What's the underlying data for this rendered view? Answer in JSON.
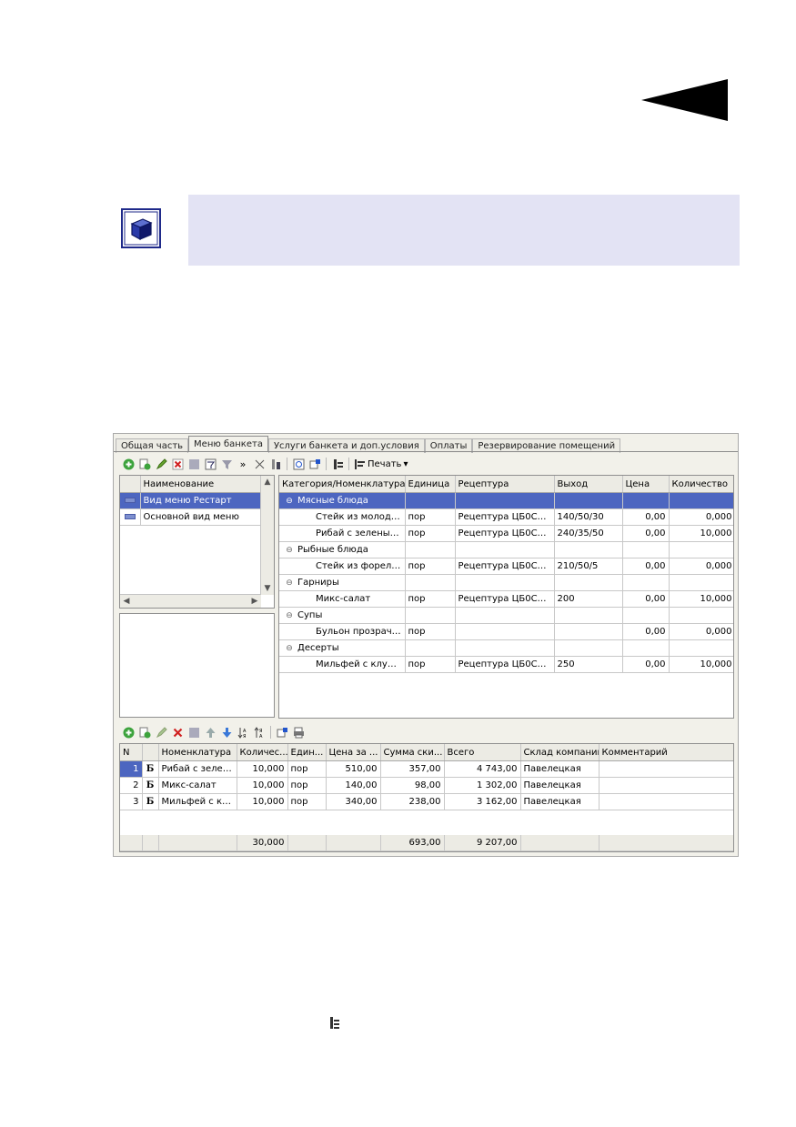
{
  "tabs": [
    {
      "label": "Общая часть"
    },
    {
      "label": "Меню банкета"
    },
    {
      "label": "Услуги банкета и доп.условия"
    },
    {
      "label": "Оплаты"
    },
    {
      "label": "Резервирование помещений"
    }
  ],
  "toolbar_top": {
    "print_label": "Печать"
  },
  "left_list": {
    "header": "Наименование",
    "rows": [
      {
        "name": "Вид меню Рестарт"
      },
      {
        "name": "Основной вид меню"
      }
    ]
  },
  "menu_table": {
    "headers": [
      "Категория/Номенклатура",
      "Единица",
      "Рецептура",
      "Выход",
      "Цена",
      "Количество"
    ],
    "rows": [
      {
        "kind": "group",
        "name": "Мясные блюда",
        "unit": "",
        "recipe": "",
        "output": "",
        "price": "",
        "qty": ""
      },
      {
        "kind": "item",
        "name": "Стейк из молодо...",
        "unit": "пор",
        "recipe": "Рецептура ЦБ0С00...",
        "output": "140/50/30",
        "price": "0,00",
        "qty": "0,000"
      },
      {
        "kind": "item",
        "name": "Рибай с зеленым...",
        "unit": "пор",
        "recipe": "Рецептура ЦБ0С00...",
        "output": "240/35/50",
        "price": "0,00",
        "qty": "10,000"
      },
      {
        "kind": "group",
        "name": "Рыбные блюда",
        "unit": "",
        "recipe": "",
        "output": "",
        "price": "",
        "qty": ""
      },
      {
        "kind": "item",
        "name": "Стейк из форели ...",
        "unit": "пор",
        "recipe": "Рецептура ЦБ0С00...",
        "output": "210/50/5",
        "price": "0,00",
        "qty": "0,000"
      },
      {
        "kind": "group",
        "name": "Гарниры",
        "unit": "",
        "recipe": "",
        "output": "",
        "price": "",
        "qty": ""
      },
      {
        "kind": "item",
        "name": "Микс-салат",
        "unit": "пор",
        "recipe": "Рецептура ЦБ0С00...",
        "output": "200",
        "price": "0,00",
        "qty": "10,000"
      },
      {
        "kind": "group",
        "name": "Супы",
        "unit": "",
        "recipe": "",
        "output": "",
        "price": "",
        "qty": ""
      },
      {
        "kind": "item",
        "name": "Бульон прозрачн...",
        "unit": "пор",
        "recipe": "",
        "output": "",
        "price": "0,00",
        "qty": "0,000"
      },
      {
        "kind": "group",
        "name": "Десерты",
        "unit": "",
        "recipe": "",
        "output": "",
        "price": "",
        "qty": ""
      },
      {
        "kind": "item",
        "name": "Мильфей с клубн...",
        "unit": "пор",
        "recipe": "Рецептура ЦБ0С00...",
        "output": "250",
        "price": "0,00",
        "qty": "10,000"
      }
    ]
  },
  "order_table": {
    "headers": [
      "N",
      "",
      "Номенклатура",
      "Количес...",
      "Един...",
      "Цена за ...",
      "Сумма ски...",
      "Всего",
      "Склад компании",
      "Комментарий"
    ],
    "rows": [
      {
        "n": "1",
        "mark": "Б",
        "name": "Рибай с зелен...",
        "qty": "10,000",
        "unit": "пор",
        "price": "510,00",
        "discount": "357,00",
        "total": "4 743,00",
        "store": "Павелецкая",
        "comment": ""
      },
      {
        "n": "2",
        "mark": "Б",
        "name": "Микс-салат",
        "qty": "10,000",
        "unit": "пор",
        "price": "140,00",
        "discount": "98,00",
        "total": "1 302,00",
        "store": "Павелецкая",
        "comment": ""
      },
      {
        "n": "3",
        "mark": "Б",
        "name": "Мильфей с кл...",
        "qty": "10,000",
        "unit": "пор",
        "price": "340,00",
        "discount": "238,00",
        "total": "3 162,00",
        "store": "Павелецкая",
        "comment": ""
      }
    ],
    "totals": {
      "qty": "30,000",
      "discount": "693,00",
      "total": "9 207,00"
    }
  }
}
